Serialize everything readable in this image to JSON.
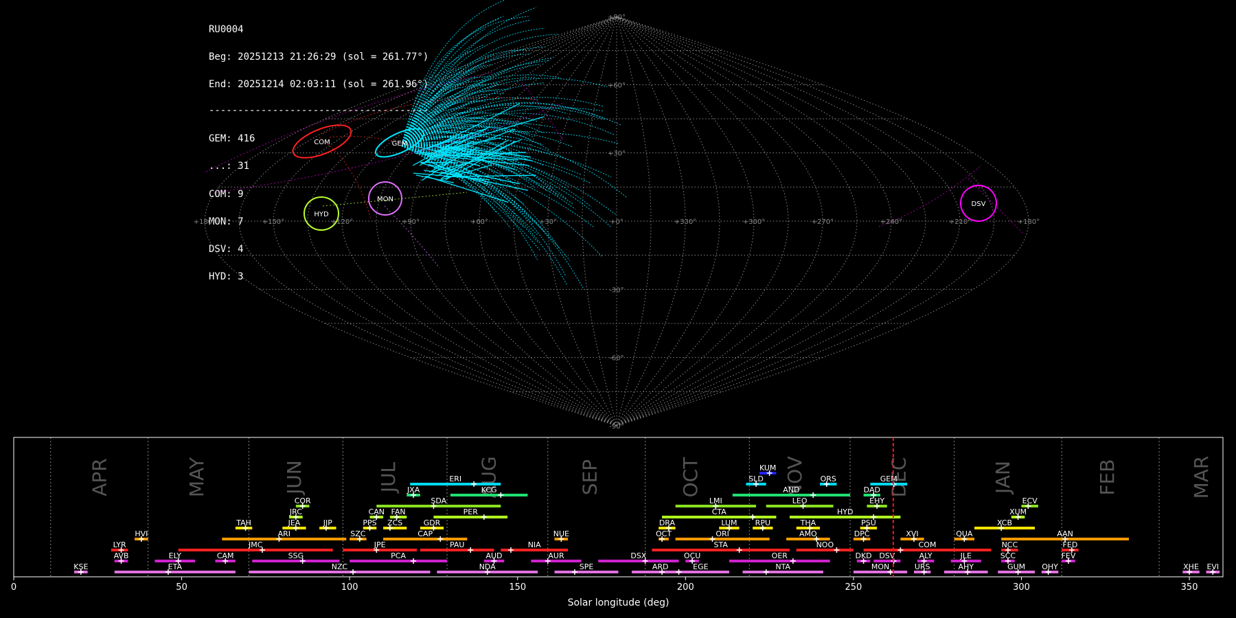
{
  "info": {
    "station": "RU0004",
    "begin": "Beg: 20251213 21:26:29 (sol = 261.77°)",
    "end": "End: 20251214 02:03:11 (sol = 261.96°)",
    "separator": "--------------------------------------",
    "counts": [
      "GEM: 416",
      "...: 31",
      "COM: 9",
      "MON: 7",
      "DSV: 4",
      "HYD: 3"
    ]
  },
  "colors": {
    "background": "#000000",
    "GEM": "#00e5ff",
    "COM": "#ff2020",
    "MON": "#e070ff",
    "HYD": "#b8ff30",
    "DSV": "#ff00ff",
    "sporadic": "#cc00cc",
    "grid": "#8a8a8a",
    "current_sol": "#ff1010"
  },
  "chart_data": [
    {
      "type": "scatter",
      "projection": "sinusoidal",
      "lon_tick_labels": [
        "+180°",
        "+150°",
        "+120°",
        "+90°",
        "+60°",
        "+30°",
        "+0°",
        "+330°",
        "+300°",
        "+270°",
        "+240°",
        "+210°",
        "+180°"
      ],
      "lat_tick_labels": [
        "+90°",
        "+60°",
        "+30°",
        "-30°",
        "-60°",
        "-90°"
      ],
      "grid": true,
      "radiants": [
        {
          "name": "COM",
          "lon": 141,
          "lat": 33,
          "color": "#ff2020"
        },
        {
          "name": "GEM",
          "lon": 112,
          "lat": 33,
          "color": "#00e5ff"
        },
        {
          "name": "MON",
          "lon": 101,
          "lat": 9,
          "color": "#e070ff"
        },
        {
          "name": "HYD",
          "lon": 130,
          "lat": 3,
          "color": "#b8ff30"
        },
        {
          "name": "DSV",
          "lon": 199,
          "lat": 10,
          "color": "#ff00ff"
        }
      ]
    },
    {
      "type": "bar",
      "orientation": "horizontal",
      "xlabel": "Solar longitude (deg)",
      "xlim": [
        0,
        360
      ],
      "xticks": [
        0,
        50,
        100,
        150,
        200,
        250,
        300,
        350
      ],
      "current_sol": 261.85,
      "months": [
        {
          "name": "APR",
          "center": 25
        },
        {
          "name": "MAY",
          "center": 54
        },
        {
          "name": "JUN",
          "center": 83
        },
        {
          "name": "JUL",
          "center": 111
        },
        {
          "name": "AUG",
          "center": 141
        },
        {
          "name": "SEP",
          "center": 171
        },
        {
          "name": "OCT",
          "center": 201
        },
        {
          "name": "NOV",
          "center": 232
        },
        {
          "name": "DEC",
          "center": 263
        },
        {
          "name": "JAN",
          "center": 294
        },
        {
          "name": "FEB",
          "center": 325
        },
        {
          "name": "MAR",
          "center": 353
        }
      ],
      "month_boundaries": [
        11,
        40,
        70,
        98,
        129,
        159,
        188,
        219,
        249,
        280,
        312,
        341
      ],
      "showers": [
        {
          "code": "KSE",
          "row": 0,
          "start": 18,
          "end": 22,
          "peak": 20,
          "color": "#e070e0"
        },
        {
          "code": "ETA",
          "row": 0,
          "start": 30,
          "end": 66,
          "peak": 46,
          "color": "#e070e0"
        },
        {
          "code": "NZC",
          "row": 0,
          "start": 70,
          "end": 124,
          "peak": 101,
          "color": "#e070e0"
        },
        {
          "code": "NDA",
          "row": 0,
          "start": 126,
          "end": 156,
          "peak": 141,
          "color": "#e070e0"
        },
        {
          "code": "SPE",
          "row": 0,
          "start": 161,
          "end": 180,
          "peak": 167,
          "color": "#e070e0"
        },
        {
          "code": "ARD",
          "row": 0,
          "start": 184,
          "end": 201,
          "peak": 193,
          "color": "#e070e0"
        },
        {
          "code": "EGE",
          "row": 0,
          "start": 196,
          "end": 213,
          "peak": 198,
          "color": "#e070e0"
        },
        {
          "code": "NTA",
          "row": 0,
          "start": 217,
          "end": 241,
          "peak": 224,
          "color": "#e070e0"
        },
        {
          "code": "MON",
          "row": 0,
          "start": 250,
          "end": 266,
          "peak": 261,
          "color": "#e070e0"
        },
        {
          "code": "URS",
          "row": 0,
          "start": 268,
          "end": 273,
          "peak": 271,
          "color": "#e070e0"
        },
        {
          "code": "AHY",
          "row": 0,
          "start": 277,
          "end": 290,
          "peak": 284,
          "color": "#e070e0"
        },
        {
          "code": "GUM",
          "row": 0,
          "start": 293,
          "end": 304,
          "peak": 299,
          "color": "#e070e0"
        },
        {
          "code": "OHY",
          "row": 0,
          "start": 306,
          "end": 311,
          "peak": 308,
          "color": "#e070e0"
        },
        {
          "code": "XHE",
          "row": 0,
          "start": 348,
          "end": 353,
          "peak": 350,
          "color": "#e070e0"
        },
        {
          "code": "EVI",
          "row": 0,
          "start": 355,
          "end": 359,
          "peak": 357,
          "color": "#e070e0"
        },
        {
          "code": "AVB",
          "row": 1,
          "start": 30,
          "end": 34,
          "peak": 32,
          "color": "#cc22cc"
        },
        {
          "code": "ELY",
          "row": 1,
          "start": 42,
          "end": 54,
          "peak": 49,
          "color": "#cc22cc"
        },
        {
          "code": "CAM",
          "row": 1,
          "start": 60,
          "end": 66,
          "peak": 63,
          "color": "#cc22cc"
        },
        {
          "code": "SSG",
          "row": 1,
          "start": 71,
          "end": 97,
          "peak": 86,
          "color": "#cc22cc"
        },
        {
          "code": "PCA",
          "row": 1,
          "start": 100,
          "end": 129,
          "peak": 119,
          "color": "#cc22cc"
        },
        {
          "code": "AUD",
          "row": 1,
          "start": 140,
          "end": 146,
          "peak": 143,
          "color": "#cc22cc"
        },
        {
          "code": "AUR",
          "row": 1,
          "start": 154,
          "end": 169,
          "peak": 159,
          "color": "#cc22cc"
        },
        {
          "code": "DSX",
          "row": 1,
          "start": 174,
          "end": 198,
          "peak": 188,
          "color": "#cc22cc"
        },
        {
          "code": "OCU",
          "row": 1,
          "start": 200,
          "end": 204,
          "peak": 202,
          "color": "#cc22cc"
        },
        {
          "code": "OER",
          "row": 1,
          "start": 213,
          "end": 243,
          "peak": 232,
          "color": "#cc22cc"
        },
        {
          "code": "DKD",
          "row": 1,
          "start": 251,
          "end": 255,
          "peak": 253,
          "color": "#cc22cc"
        },
        {
          "code": "DSV",
          "row": 1,
          "start": 256,
          "end": 264,
          "peak": 262,
          "color": "#cc22cc"
        },
        {
          "code": "ALY",
          "row": 1,
          "start": 269,
          "end": 274,
          "peak": 271,
          "color": "#cc22cc"
        },
        {
          "code": "JLE",
          "row": 1,
          "start": 279,
          "end": 288,
          "peak": 283,
          "color": "#cc22cc"
        },
        {
          "code": "SCC",
          "row": 1,
          "start": 294,
          "end": 298,
          "peak": 296,
          "color": "#cc22cc"
        },
        {
          "code": "FEV",
          "row": 1,
          "start": 312,
          "end": 316,
          "peak": 314,
          "color": "#cc22cc"
        },
        {
          "code": "LYR",
          "row": 2,
          "start": 29,
          "end": 34,
          "peak": 32,
          "color": "#ff2020"
        },
        {
          "code": "JMC",
          "row": 2,
          "start": 49,
          "end": 95,
          "peak": 74,
          "color": "#ff2020"
        },
        {
          "code": "JPE",
          "row": 2,
          "start": 98,
          "end": 120,
          "peak": 108,
          "color": "#ff2020"
        },
        {
          "code": "PAU",
          "row": 2,
          "start": 121,
          "end": 143,
          "peak": 136,
          "color": "#ff2020"
        },
        {
          "code": "NIA",
          "row": 2,
          "start": 145,
          "end": 165,
          "peak": 148,
          "color": "#ff2020"
        },
        {
          "code": "STA",
          "row": 2,
          "start": 190,
          "end": 231,
          "peak": 216,
          "color": "#ff2020"
        },
        {
          "code": "NOO",
          "row": 2,
          "start": 233,
          "end": 250,
          "peak": 245,
          "color": "#ff2020"
        },
        {
          "code": "COM",
          "row": 2,
          "start": 253,
          "end": 291,
          "peak": 264,
          "color": "#ff2020"
        },
        {
          "code": "NCC",
          "row": 2,
          "start": 294,
          "end": 299,
          "peak": 296,
          "color": "#ff2020"
        },
        {
          "code": "FED",
          "row": 2,
          "start": 312,
          "end": 317,
          "peak": 315,
          "color": "#ff2020"
        },
        {
          "code": "HVI",
          "row": 3,
          "start": 36,
          "end": 40,
          "peak": 38,
          "color": "#ff9a00"
        },
        {
          "code": "ARI",
          "row": 3,
          "start": 62,
          "end": 99,
          "peak": 79,
          "color": "#ff9a00"
        },
        {
          "code": "SZC",
          "row": 3,
          "start": 100,
          "end": 105,
          "peak": 103,
          "color": "#ff9a00"
        },
        {
          "code": "CAP",
          "row": 3,
          "start": 110,
          "end": 135,
          "peak": 127,
          "color": "#ff9a00"
        },
        {
          "code": "NUE",
          "row": 3,
          "start": 161,
          "end": 165,
          "peak": 163,
          "color": "#ff9a00"
        },
        {
          "code": "OCT",
          "row": 3,
          "start": 192,
          "end": 195,
          "peak": 193,
          "color": "#ff9a00"
        },
        {
          "code": "ORI",
          "row": 3,
          "start": 197,
          "end": 225,
          "peak": 208,
          "color": "#ff9a00"
        },
        {
          "code": "AMO",
          "row": 3,
          "start": 230,
          "end": 243,
          "peak": 239,
          "color": "#ff9a00"
        },
        {
          "code": "DPC",
          "row": 3,
          "start": 250,
          "end": 255,
          "peak": 253,
          "color": "#ff9a00"
        },
        {
          "code": "XVI",
          "row": 3,
          "start": 264,
          "end": 271,
          "peak": 268,
          "color": "#ff9a00"
        },
        {
          "code": "QUA",
          "row": 3,
          "start": 280,
          "end": 286,
          "peak": 283,
          "color": "#ff9a00"
        },
        {
          "code": "AAN",
          "row": 3,
          "start": 294,
          "end": 332,
          "peak": 313,
          "color": "#ff9a00"
        },
        {
          "code": "TAH",
          "row": 4,
          "start": 66,
          "end": 71,
          "peak": 69,
          "color": "#ffe400"
        },
        {
          "code": "JEA",
          "row": 4,
          "start": 80,
          "end": 87,
          "peak": 84,
          "color": "#ffe400"
        },
        {
          "code": "JIP",
          "row": 4,
          "start": 91,
          "end": 96,
          "peak": 93,
          "color": "#ffe400"
        },
        {
          "code": "PPS",
          "row": 4,
          "start": 104,
          "end": 108,
          "peak": 106,
          "color": "#ffe400"
        },
        {
          "code": "ZCS",
          "row": 4,
          "start": 110,
          "end": 117,
          "peak": 112,
          "color": "#ffe400"
        },
        {
          "code": "GDR",
          "row": 4,
          "start": 121,
          "end": 128,
          "peak": 125,
          "color": "#ffe400"
        },
        {
          "code": "DRA",
          "row": 4,
          "start": 192,
          "end": 197,
          "peak": 195,
          "color": "#ffe400"
        },
        {
          "code": "LUM",
          "row": 4,
          "start": 210,
          "end": 216,
          "peak": 213,
          "color": "#ffe400"
        },
        {
          "code": "RPU",
          "row": 4,
          "start": 220,
          "end": 226,
          "peak": 223,
          "color": "#ffe400"
        },
        {
          "code": "THA",
          "row": 4,
          "start": 233,
          "end": 240,
          "peak": 237,
          "color": "#ffe400"
        },
        {
          "code": "PSU",
          "row": 4,
          "start": 252,
          "end": 257,
          "peak": 254,
          "color": "#ffe400"
        },
        {
          "code": "XCB",
          "row": 4,
          "start": 286,
          "end": 304,
          "peak": 294,
          "color": "#ffe400"
        },
        {
          "code": "CAN",
          "row": 5,
          "start": 106,
          "end": 110,
          "peak": 108,
          "color": "#b0ff20"
        },
        {
          "code": "FAN",
          "row": 5,
          "start": 112,
          "end": 117,
          "peak": 114,
          "color": "#b0ff20"
        },
        {
          "code": "JRC",
          "row": 5,
          "start": 82,
          "end": 86,
          "peak": 84,
          "color": "#b0ff20"
        },
        {
          "code": "PER",
          "row": 5,
          "start": 125,
          "end": 147,
          "peak": 140,
          "color": "#b0ff20"
        },
        {
          "code": "CTA",
          "row": 5,
          "start": 193,
          "end": 227,
          "peak": 220,
          "color": "#b0ff20"
        },
        {
          "code": "HYD",
          "row": 5,
          "start": 231,
          "end": 264,
          "peak": 256,
          "color": "#b0ff20"
        },
        {
          "code": "XUM",
          "row": 5,
          "start": 297,
          "end": 301,
          "peak": 299,
          "color": "#b0ff20"
        },
        {
          "code": "COR",
          "row": 6,
          "start": 84,
          "end": 88,
          "peak": 86,
          "color": "#8ae020"
        },
        {
          "code": "SDA",
          "row": 6,
          "start": 108,
          "end": 145,
          "peak": 125,
          "color": "#8ae020"
        },
        {
          "code": "LMI",
          "row": 6,
          "start": 197,
          "end": 221,
          "peak": 209,
          "color": "#8ae020"
        },
        {
          "code": "LEO",
          "row": 6,
          "start": 224,
          "end": 244,
          "peak": 235,
          "color": "#8ae020"
        },
        {
          "code": "EHY",
          "row": 6,
          "start": 254,
          "end": 260,
          "peak": 257,
          "color": "#8ae020"
        },
        {
          "code": "ECV",
          "row": 6,
          "start": 300,
          "end": 305,
          "peak": 302,
          "color": "#8ae020"
        },
        {
          "code": "JXA",
          "row": 7,
          "start": 117,
          "end": 121,
          "peak": 119,
          "color": "#20e070"
        },
        {
          "code": "KCG",
          "row": 7,
          "start": 130,
          "end": 153,
          "peak": 145,
          "color": "#20e070"
        },
        {
          "code": "AND",
          "row": 7,
          "start": 214,
          "end": 249,
          "peak": 238,
          "color": "#20e070"
        },
        {
          "code": "DAD",
          "row": 7,
          "start": 253,
          "end": 258,
          "peak": 256,
          "color": "#20e070"
        },
        {
          "code": "ERI",
          "row": 8,
          "start": 118,
          "end": 145,
          "peak": 137,
          "color": "#00d8f0"
        },
        {
          "code": "SLD",
          "row": 8,
          "start": 218,
          "end": 224,
          "peak": 221,
          "color": "#00d8f0"
        },
        {
          "code": "ORS",
          "row": 8,
          "start": 240,
          "end": 245,
          "peak": 242,
          "color": "#00d8f0"
        },
        {
          "code": "GEM",
          "row": 8,
          "start": 255,
          "end": 266,
          "peak": 262,
          "color": "#00d8f0"
        },
        {
          "code": "KUM",
          "row": 9,
          "start": 222,
          "end": 227,
          "peak": 225,
          "color": "#2020ff"
        }
      ]
    }
  ]
}
